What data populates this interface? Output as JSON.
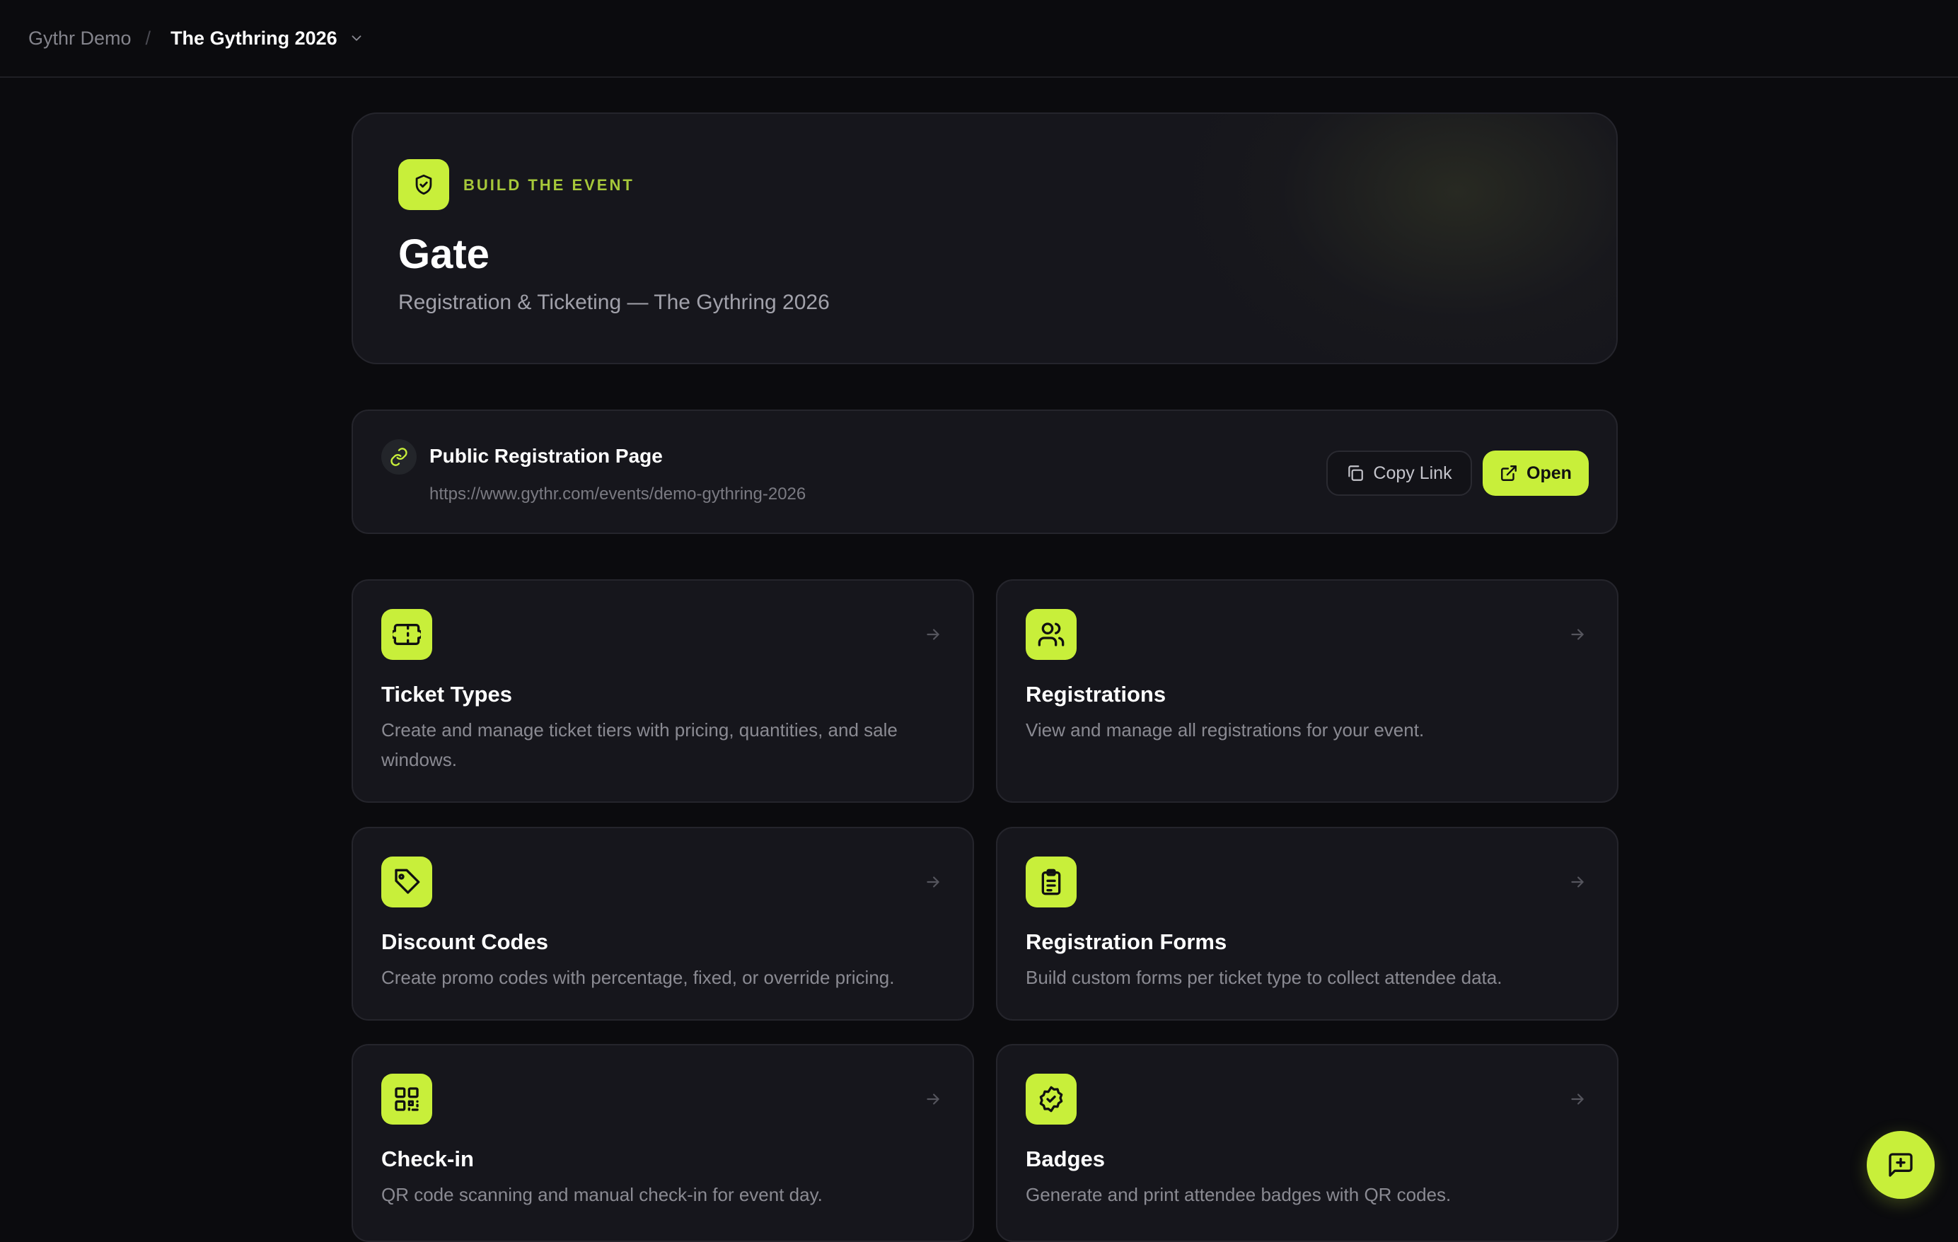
{
  "breadcrumb": {
    "root": "Gythr Demo",
    "separator": "/",
    "current": "The Gythring 2026"
  },
  "hero": {
    "kicker": "BUILD THE EVENT",
    "title": "Gate",
    "subtitle": "Registration & Ticketing — The Gythring 2026",
    "icon": "shield-check-icon"
  },
  "registration_page": {
    "title": "Public Registration Page",
    "url": "https://www.gythr.com/events/demo-gythring-2026",
    "copy_label": "Copy Link",
    "open_label": "Open"
  },
  "cards": [
    {
      "title": "Ticket Types",
      "description": "Create and manage ticket tiers with pricing, quantities, and sale windows.",
      "icon": "ticket-icon"
    },
    {
      "title": "Registrations",
      "description": "View and manage all registrations for your event.",
      "icon": "users-icon"
    },
    {
      "title": "Discount Codes",
      "description": "Create promo codes with percentage, fixed, or override pricing.",
      "icon": "tag-icon"
    },
    {
      "title": "Registration Forms",
      "description": "Build custom forms per ticket type to collect attendee data.",
      "icon": "clipboard-list-icon"
    },
    {
      "title": "Check-in",
      "description": "QR code scanning and manual check-in for event day.",
      "icon": "qr-code-icon"
    },
    {
      "title": "Badges",
      "description": "Generate and print attendee badges with QR codes.",
      "icon": "badge-check-icon"
    }
  ],
  "theme": {
    "accent": "#c8ef3a",
    "background": "#0b0b0e",
    "card": "#16161c"
  }
}
